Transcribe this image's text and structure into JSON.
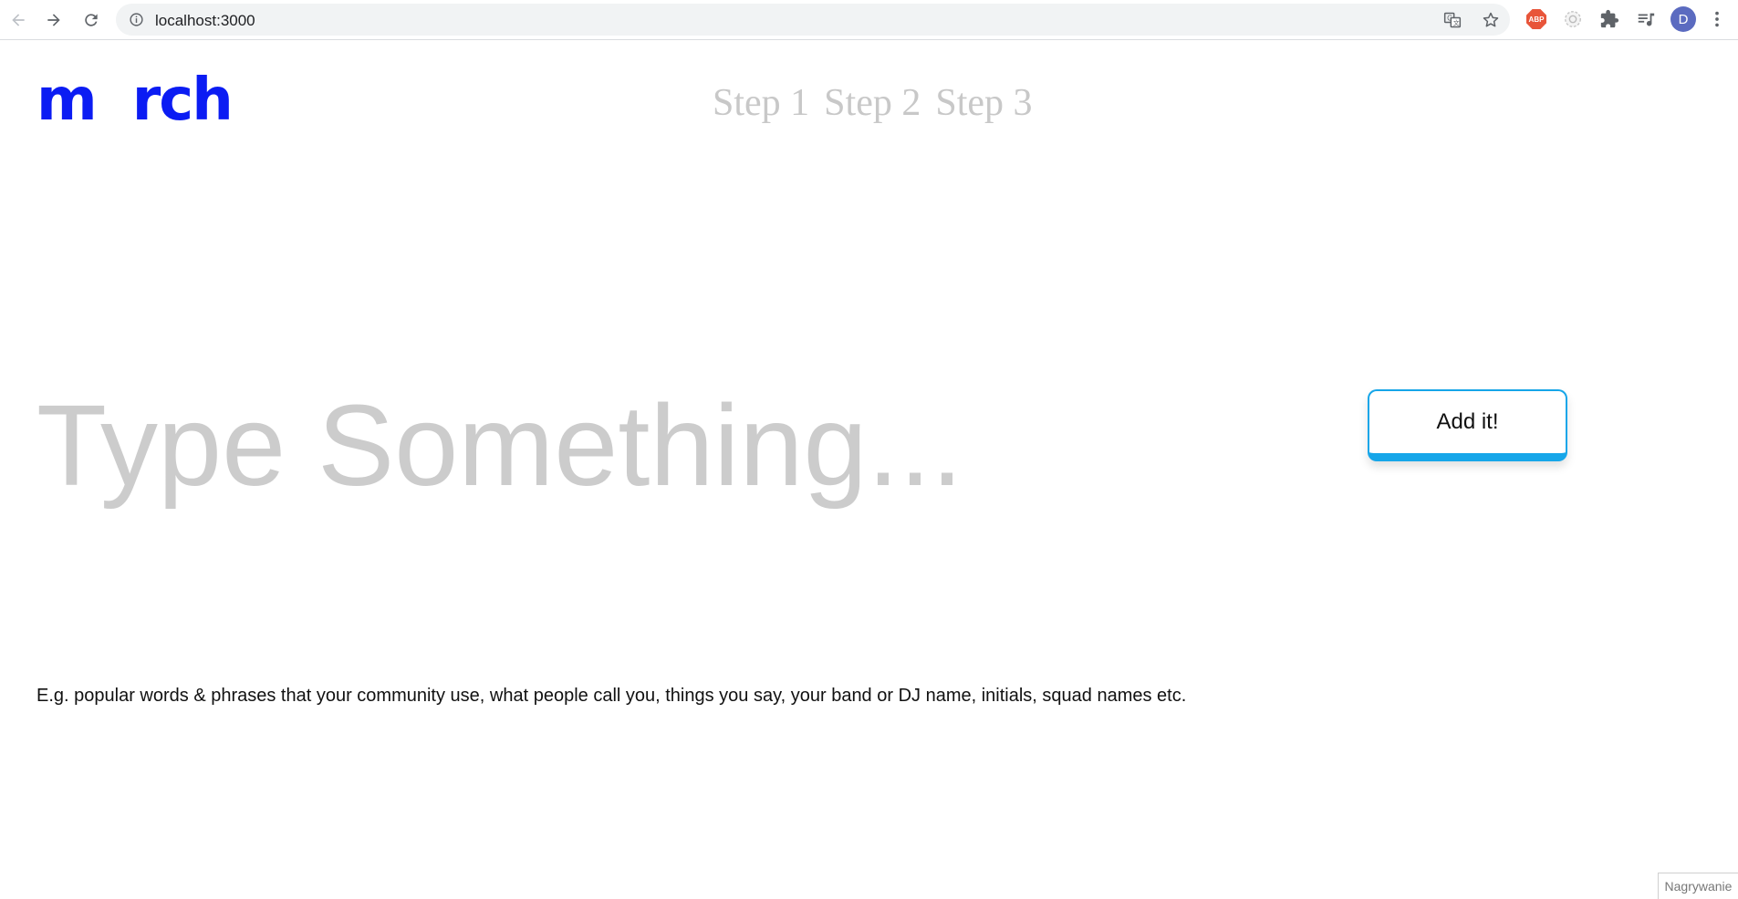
{
  "browser": {
    "url": "localhost:3000",
    "avatar_letter": "D",
    "abp_label": "ABP",
    "icons": [
      "back-arrow-icon",
      "forward-arrow-icon",
      "reload-icon",
      "info-icon",
      "translate-icon",
      "star-icon",
      "adblock-icon",
      "extension-circle-icon",
      "puzzle-extensions-icon",
      "media-queue-icon",
      "kebab-menu-icon"
    ]
  },
  "header": {
    "logo_left": "m",
    "logo_right": "rch",
    "steps": [
      "Step 1",
      "Step 2",
      "Step 3"
    ]
  },
  "main": {
    "input_placeholder": "Type Something...",
    "input_value": "",
    "add_button_label": "Add it!",
    "hint": "E.g. popular words & phrases that your community use, what people call you, things you say, your band or DJ name, initials, squad names etc."
  },
  "overlay": {
    "recording_label": "Nagrywanie"
  },
  "colors": {
    "brand": "#0b1cf3",
    "accent": "#16a6e9",
    "step_gray": "#c8c8c8",
    "placeholder_gray": "#cccccc"
  }
}
